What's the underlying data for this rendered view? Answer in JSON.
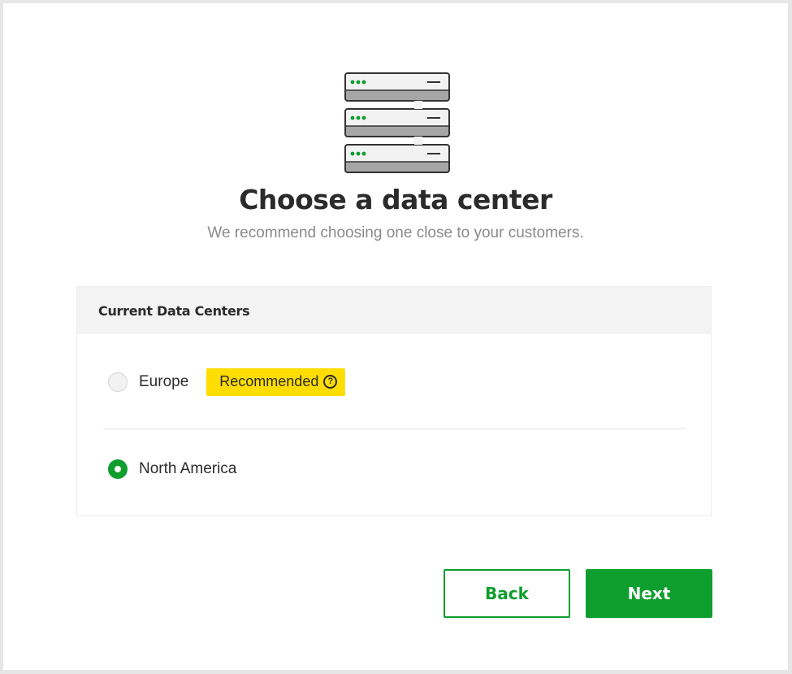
{
  "header": {
    "title": "Choose a data center",
    "subtitle": "We recommend choosing one close to your customers."
  },
  "panel": {
    "heading": "Current Data Centers",
    "options": [
      {
        "label": "Europe",
        "selected": false,
        "badge": "Recommended",
        "badge_icon": "help-icon"
      },
      {
        "label": "North America",
        "selected": true
      }
    ]
  },
  "buttons": {
    "back_label": "Back",
    "next_label": "Next"
  },
  "colors": {
    "accent": "#0e9e2e",
    "badge": "#ffdd00",
    "text": "#2b2b2b",
    "muted": "#8a8a8a"
  },
  "icons": {
    "illustration": "server-rack-icon",
    "help_glyph": "?"
  }
}
